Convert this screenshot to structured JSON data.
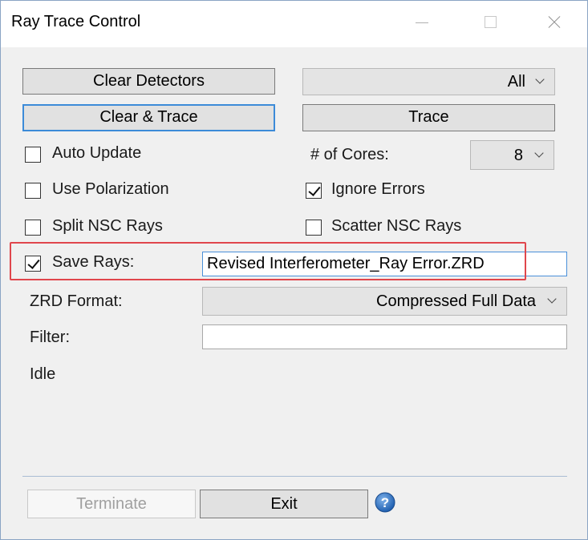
{
  "window": {
    "title": "Ray Trace Control"
  },
  "buttons": {
    "clear_detectors": "Clear Detectors",
    "clear_and_trace": "Clear & Trace",
    "trace": "Trace",
    "terminate": "Terminate",
    "exit": "Exit"
  },
  "detector_select": {
    "value": "All"
  },
  "cores": {
    "label": "# of Cores:",
    "value": "8"
  },
  "options": {
    "auto_update": {
      "label": "Auto Update",
      "checked": false
    },
    "use_polarization": {
      "label": "Use Polarization",
      "checked": false
    },
    "split_nsc_rays": {
      "label": "Split NSC Rays",
      "checked": false
    },
    "ignore_errors": {
      "label": "Ignore Errors",
      "checked": true
    },
    "scatter_nsc_rays": {
      "label": "Scatter NSC Rays",
      "checked": false
    },
    "save_rays": {
      "label": "Save Rays:",
      "checked": true
    }
  },
  "save_rays_file": {
    "value": "Revised Interferometer_Ray Error.ZRD"
  },
  "zrd_format": {
    "label": "ZRD Format:",
    "value": "Compressed Full Data"
  },
  "filter": {
    "label": "Filter:",
    "value": ""
  },
  "status": {
    "text": "Idle"
  },
  "colors": {
    "highlight": "#e0464c",
    "focus": "#3c8bd8",
    "help": "#2f6fc0"
  },
  "icons": {
    "help": "help-icon",
    "close": "close-icon",
    "maximize": "maximize-icon",
    "minimize": "minimize-icon"
  }
}
